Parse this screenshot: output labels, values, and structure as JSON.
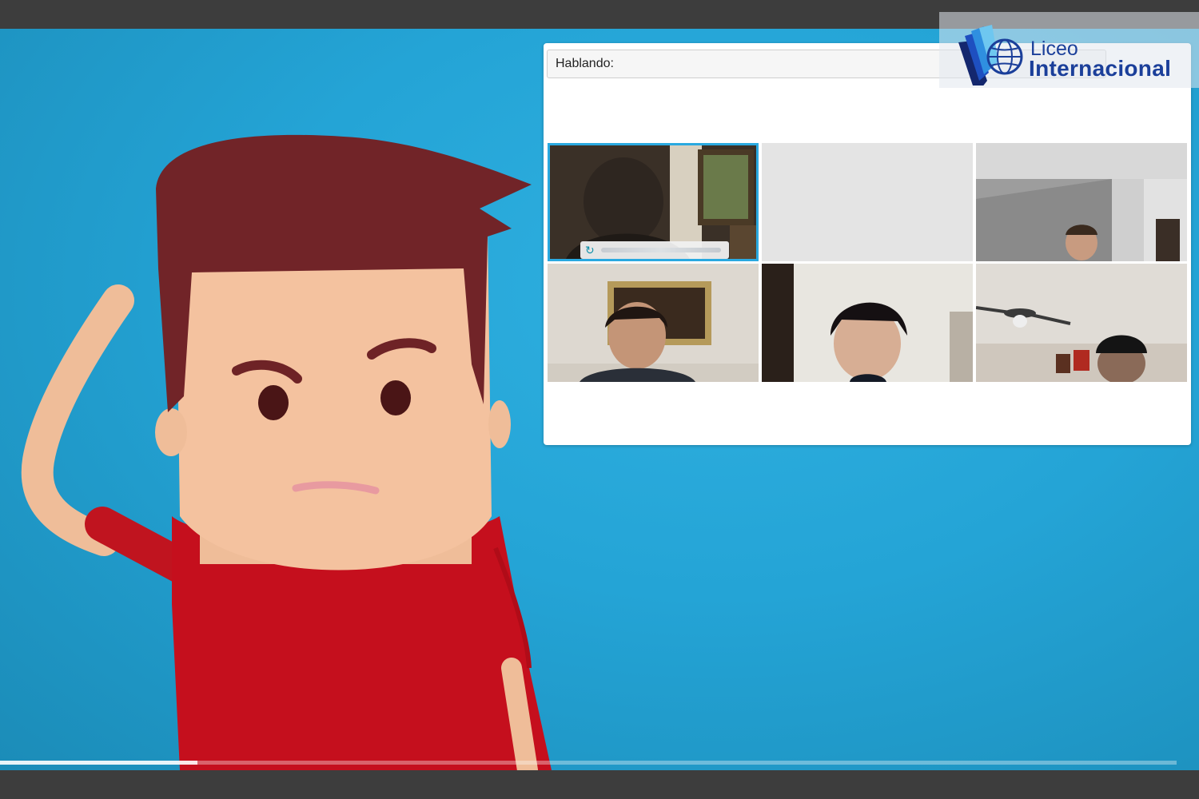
{
  "meeting": {
    "speaking_label": "Hablando:",
    "participant_count": 6,
    "active_tile_border_color": "#2aa9e0"
  },
  "logo": {
    "line1": "Liceo",
    "line2": "Internacional",
    "color": "#1b3f9a"
  },
  "video": {
    "background_color": "#24a4d6",
    "progress_percent": 16.8
  },
  "icons": {
    "participant_status": "sync-icon"
  }
}
